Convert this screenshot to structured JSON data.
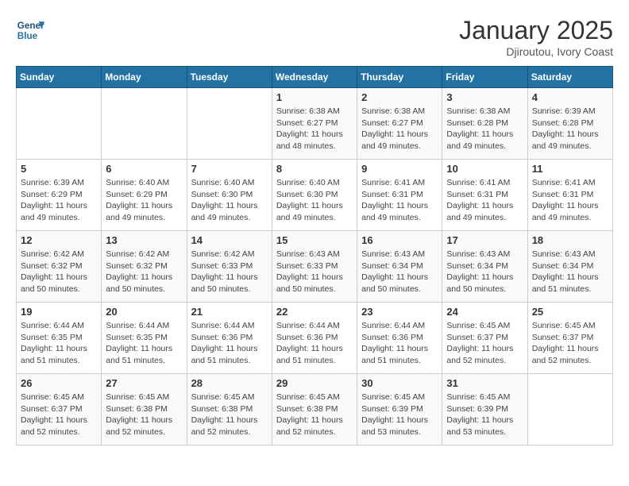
{
  "header": {
    "logo_line1": "General",
    "logo_line2": "Blue",
    "month": "January 2025",
    "location": "Djiroutou, Ivory Coast"
  },
  "weekdays": [
    "Sunday",
    "Monday",
    "Tuesday",
    "Wednesday",
    "Thursday",
    "Friday",
    "Saturday"
  ],
  "weeks": [
    [
      {
        "day": "",
        "info": ""
      },
      {
        "day": "",
        "info": ""
      },
      {
        "day": "",
        "info": ""
      },
      {
        "day": "1",
        "info": "Sunrise: 6:38 AM\nSunset: 6:27 PM\nDaylight: 11 hours\nand 48 minutes."
      },
      {
        "day": "2",
        "info": "Sunrise: 6:38 AM\nSunset: 6:27 PM\nDaylight: 11 hours\nand 49 minutes."
      },
      {
        "day": "3",
        "info": "Sunrise: 6:38 AM\nSunset: 6:28 PM\nDaylight: 11 hours\nand 49 minutes."
      },
      {
        "day": "4",
        "info": "Sunrise: 6:39 AM\nSunset: 6:28 PM\nDaylight: 11 hours\nand 49 minutes."
      }
    ],
    [
      {
        "day": "5",
        "info": "Sunrise: 6:39 AM\nSunset: 6:29 PM\nDaylight: 11 hours\nand 49 minutes."
      },
      {
        "day": "6",
        "info": "Sunrise: 6:40 AM\nSunset: 6:29 PM\nDaylight: 11 hours\nand 49 minutes."
      },
      {
        "day": "7",
        "info": "Sunrise: 6:40 AM\nSunset: 6:30 PM\nDaylight: 11 hours\nand 49 minutes."
      },
      {
        "day": "8",
        "info": "Sunrise: 6:40 AM\nSunset: 6:30 PM\nDaylight: 11 hours\nand 49 minutes."
      },
      {
        "day": "9",
        "info": "Sunrise: 6:41 AM\nSunset: 6:31 PM\nDaylight: 11 hours\nand 49 minutes."
      },
      {
        "day": "10",
        "info": "Sunrise: 6:41 AM\nSunset: 6:31 PM\nDaylight: 11 hours\nand 49 minutes."
      },
      {
        "day": "11",
        "info": "Sunrise: 6:41 AM\nSunset: 6:31 PM\nDaylight: 11 hours\nand 49 minutes."
      }
    ],
    [
      {
        "day": "12",
        "info": "Sunrise: 6:42 AM\nSunset: 6:32 PM\nDaylight: 11 hours\nand 50 minutes."
      },
      {
        "day": "13",
        "info": "Sunrise: 6:42 AM\nSunset: 6:32 PM\nDaylight: 11 hours\nand 50 minutes."
      },
      {
        "day": "14",
        "info": "Sunrise: 6:42 AM\nSunset: 6:33 PM\nDaylight: 11 hours\nand 50 minutes."
      },
      {
        "day": "15",
        "info": "Sunrise: 6:43 AM\nSunset: 6:33 PM\nDaylight: 11 hours\nand 50 minutes."
      },
      {
        "day": "16",
        "info": "Sunrise: 6:43 AM\nSunset: 6:34 PM\nDaylight: 11 hours\nand 50 minutes."
      },
      {
        "day": "17",
        "info": "Sunrise: 6:43 AM\nSunset: 6:34 PM\nDaylight: 11 hours\nand 50 minutes."
      },
      {
        "day": "18",
        "info": "Sunrise: 6:43 AM\nSunset: 6:34 PM\nDaylight: 11 hours\nand 51 minutes."
      }
    ],
    [
      {
        "day": "19",
        "info": "Sunrise: 6:44 AM\nSunset: 6:35 PM\nDaylight: 11 hours\nand 51 minutes."
      },
      {
        "day": "20",
        "info": "Sunrise: 6:44 AM\nSunset: 6:35 PM\nDaylight: 11 hours\nand 51 minutes."
      },
      {
        "day": "21",
        "info": "Sunrise: 6:44 AM\nSunset: 6:36 PM\nDaylight: 11 hours\nand 51 minutes."
      },
      {
        "day": "22",
        "info": "Sunrise: 6:44 AM\nSunset: 6:36 PM\nDaylight: 11 hours\nand 51 minutes."
      },
      {
        "day": "23",
        "info": "Sunrise: 6:44 AM\nSunset: 6:36 PM\nDaylight: 11 hours\nand 51 minutes."
      },
      {
        "day": "24",
        "info": "Sunrise: 6:45 AM\nSunset: 6:37 PM\nDaylight: 11 hours\nand 52 minutes."
      },
      {
        "day": "25",
        "info": "Sunrise: 6:45 AM\nSunset: 6:37 PM\nDaylight: 11 hours\nand 52 minutes."
      }
    ],
    [
      {
        "day": "26",
        "info": "Sunrise: 6:45 AM\nSunset: 6:37 PM\nDaylight: 11 hours\nand 52 minutes."
      },
      {
        "day": "27",
        "info": "Sunrise: 6:45 AM\nSunset: 6:38 PM\nDaylight: 11 hours\nand 52 minutes."
      },
      {
        "day": "28",
        "info": "Sunrise: 6:45 AM\nSunset: 6:38 PM\nDaylight: 11 hours\nand 52 minutes."
      },
      {
        "day": "29",
        "info": "Sunrise: 6:45 AM\nSunset: 6:38 PM\nDaylight: 11 hours\nand 52 minutes."
      },
      {
        "day": "30",
        "info": "Sunrise: 6:45 AM\nSunset: 6:39 PM\nDaylight: 11 hours\nand 53 minutes."
      },
      {
        "day": "31",
        "info": "Sunrise: 6:45 AM\nSunset: 6:39 PM\nDaylight: 11 hours\nand 53 minutes."
      },
      {
        "day": "",
        "info": ""
      }
    ]
  ]
}
